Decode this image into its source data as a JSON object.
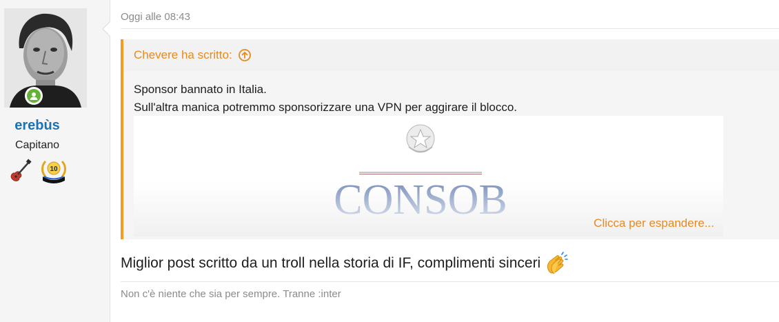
{
  "user": {
    "name": "erebùs",
    "title": "Capitano",
    "status": "online"
  },
  "post": {
    "date": "Oggi alle 08:43",
    "quote": {
      "author_line": "Chevere ha scritto:",
      "lines": [
        "Sponsor bannato in Italia.",
        "Sull'altra manica potremmo sponsorizzare una VPN per aggirare il blocco."
      ],
      "image_logo": "CONSOB",
      "expand_label": "Clicca per espandere..."
    },
    "message": "Miglior post scritto da un troll nella storia di IF, complimenti sinceri",
    "emoji": "clapping-hands",
    "signature": "Non c'è niente che sia per sempre. Tranne :inter"
  },
  "trophies": {
    "badge_number": "10"
  },
  "colors": {
    "accent": "#f39c1f",
    "username": "#1a72b5",
    "online": "#63b435"
  }
}
